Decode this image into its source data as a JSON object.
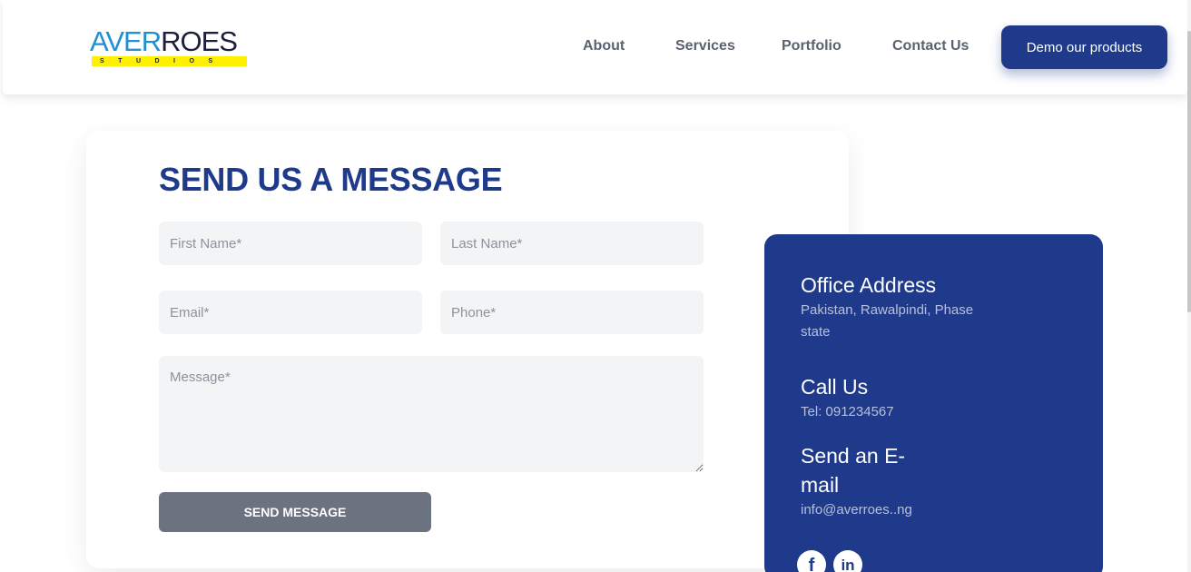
{
  "logo": {
    "part1": "AVER",
    "part2": "ROES",
    "tagline": "STUDIOS"
  },
  "nav": {
    "about": "About",
    "services": "Services",
    "portfolio": "Portfolio",
    "contact": "Contact Us",
    "demo": "Demo our products"
  },
  "form": {
    "title": "SEND US A MESSAGE",
    "first_name": "First Name*",
    "last_name": "Last Name*",
    "email": "Email*",
    "phone": "Phone*",
    "message": "Message*",
    "submit": "SEND MESSAGE"
  },
  "info": {
    "office_title": "Office Address",
    "office_line1": "Pakistan, Rawalpindi, Phase",
    "office_line2": "state",
    "call_title": "Call Us",
    "call_value": "Tel: 091234567",
    "email_title1": "Send an E-",
    "email_title2": "mail",
    "email_value": "info@averroes..ng"
  },
  "social": {
    "facebook": "f",
    "linkedin": "in"
  },
  "colors": {
    "brand": "#1f3a8a",
    "button_gray": "#6b7280",
    "field_bg": "#f3f4f6",
    "logo_blue": "#1e90d6",
    "logo_yellow": "#ffef00"
  },
  "icons": {
    "facebook": "facebook-icon",
    "linkedin": "linkedin-icon"
  }
}
